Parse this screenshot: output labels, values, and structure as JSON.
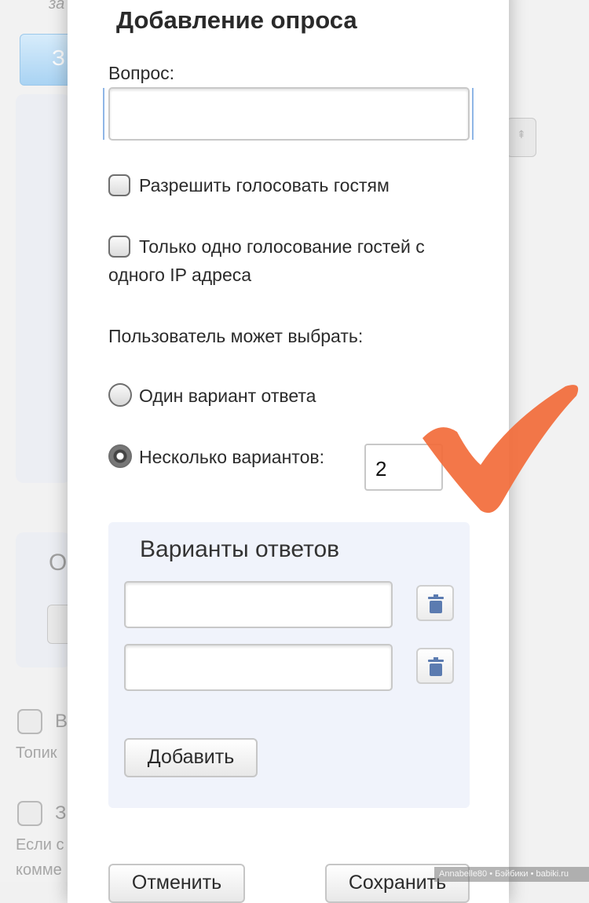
{
  "modal": {
    "title": "Добавление опроса",
    "close_glyph": "×",
    "question_label": "Вопрос:",
    "question_value": "",
    "allow_guests_label": "Разрешить голосовать гостям",
    "allow_guests_checked": false,
    "one_vote_per_ip_line1": "Только одно голосование гостей с",
    "one_vote_per_ip_line2": "одного IP адреса",
    "one_vote_per_ip_checked": false,
    "user_can_choose_label": "Пользователь может выбрать:",
    "single_option_label": "Один вариант ответа",
    "multiple_options_label": "Несколько вариантов:",
    "selected_mode": "multiple",
    "multiple_count": "2",
    "answers": {
      "title": "Варианты ответов",
      "items": [
        {
          "value": "",
          "delete_icon": "trash-icon"
        },
        {
          "value": "",
          "delete_icon": "trash-icon"
        }
      ],
      "add_button": "Добавить"
    },
    "cancel_button": "Отменить",
    "save_button": "Сохранить"
  },
  "background": {
    "top_fragment": "за",
    "button_fragment": "З",
    "section_fragment": "О",
    "option1_fragment": "В",
    "option1_hint": "Топик",
    "option2_fragment": "З",
    "option2_hint_line1": "Если с",
    "option2_hint_line2": "комме"
  },
  "overlay": {
    "checkmark_color": "#f26b3a"
  },
  "watermark": "Annabelle80 • Бэйбики • babiki.ru"
}
